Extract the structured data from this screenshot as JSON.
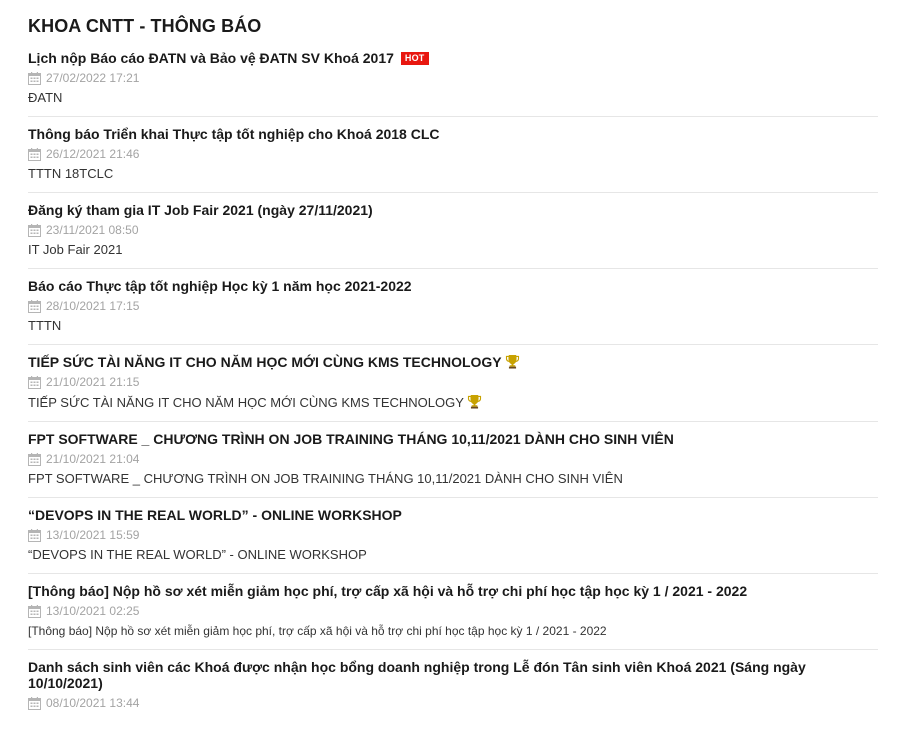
{
  "header": {
    "title": "KHOA CNTT - THÔNG BÁO"
  },
  "badge": {
    "hot_label": "HOT"
  },
  "items": [
    {
      "title": "Lịch nộp Báo cáo ĐATN và Bảo vệ ĐATN SV Khoá 2017",
      "date": "27/02/2022 17:21",
      "desc": "ĐATN"
    },
    {
      "title": "Thông báo Triển khai Thực tập tốt nghiệp cho Khoá 2018 CLC",
      "date": "26/12/2021 21:46",
      "desc": "TTTN 18TCLC"
    },
    {
      "title": "Đăng ký tham gia IT Job Fair 2021 (ngày 27/11/2021)",
      "date": "23/11/2021 08:50",
      "desc": "IT Job Fair 2021"
    },
    {
      "title": "Báo cáo Thực tập tốt nghiệp Học kỳ 1 năm học 2021-2022",
      "date": "28/10/2021 17:15",
      "desc": "TTTN"
    },
    {
      "title": "TIẾP SỨC TÀI NĂNG IT CHO NĂM HỌC MỚI CÙNG KMS TECHNOLOGY",
      "date": "21/10/2021 21:15",
      "desc": "TIẾP SỨC TÀI NĂNG IT CHO NĂM HỌC MỚI CÙNG KMS TECHNOLOGY"
    },
    {
      "title": "FPT SOFTWARE _ CHƯƠNG TRÌNH ON JOB TRAINING THÁNG 10,11/2021 DÀNH CHO SINH VIÊN",
      "date": "21/10/2021 21:04",
      "desc": "FPT SOFTWARE _ CHƯƠNG TRÌNH ON JOB TRAINING THÁNG 10,11/2021 DÀNH CHO SINH VIÊN"
    },
    {
      "title": "“DEVOPS IN THE REAL WORLD” - ONLINE WORKSHOP",
      "date": "13/10/2021 15:59",
      "desc": "“DEVOPS IN THE REAL WORLD” - ONLINE WORKSHOP"
    },
    {
      "title": "[Thông báo] Nộp hồ sơ xét miễn giảm học phí, trợ cấp xã hội và hỗ trợ chi phí học tập học kỳ 1 / 2021 - 2022",
      "date": "13/10/2021 02:25",
      "desc": "[Thông báo] Nộp hồ sơ xét miễn giảm học phí, trợ cấp xã hội và hỗ trợ chi phí học tập học kỳ 1 / 2021 - 2022"
    },
    {
      "title": "Danh sách sinh viên các Khoá được nhận học bổng doanh nghiệp trong Lễ đón Tân sinh viên Khoá 2021 (Sáng ngày 10/10/2021)",
      "date": "08/10/2021 13:44",
      "desc": ""
    }
  ],
  "colors": {
    "hot_badge": "#e8170f",
    "meta_text": "#a3a3a3",
    "divider": "#e6e6e6",
    "trophy": "#c8a200"
  },
  "icons": {
    "date": "calendar-icon",
    "trophy": "trophy-icon"
  }
}
